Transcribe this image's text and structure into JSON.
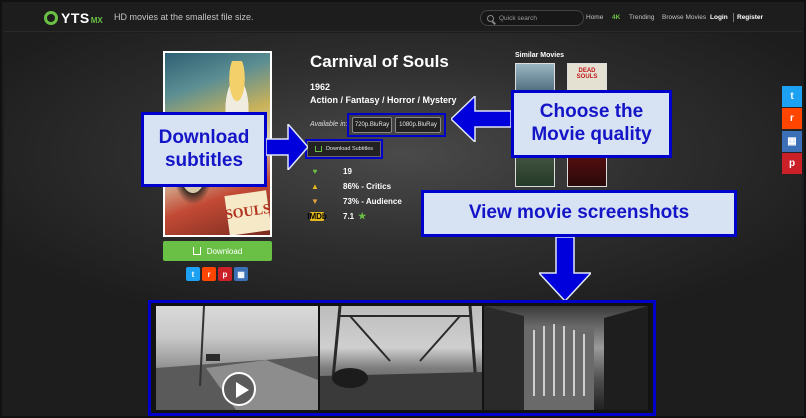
{
  "header": {
    "logo_text": "YTS",
    "logo_suffix": "MX",
    "tagline": "HD movies at the smallest file size.",
    "search_placeholder": "Quick search",
    "nav": [
      "Home",
      "4K",
      "Trending",
      "Browse Movies",
      "Login",
      "Register"
    ]
  },
  "poster": {
    "overlay_word": "SOULS"
  },
  "download_label": "Download",
  "share_icons": [
    "twitter-icon",
    "reddit-icon",
    "pinterest-icon",
    "more-icon"
  ],
  "movie": {
    "title": "Carnival of Souls",
    "year": "1962",
    "genres": "Action / Fantasy / Horror / Mystery",
    "available_label": "Available in:",
    "qualities": [
      "720p.BluRay",
      "1080p.BluRay"
    ],
    "subtitles_label": "Download Subtitles",
    "likes": "19",
    "critics": "86% - Critics",
    "audience": "73% - Audience",
    "imdb_label": "IMDb",
    "imdb_rating": "7.1"
  },
  "similar": {
    "heading": "Similar Movies",
    "items": [
      "",
      "DEAD SOULS",
      "",
      ""
    ]
  },
  "annotations": {
    "download_subtitles": "Download subtitles",
    "choose_quality": "Choose the Movie quality",
    "view_screenshots": "View movie screenshots"
  },
  "side_share": [
    "twitter-icon",
    "reddit-icon",
    "more-icon",
    "pinterest-icon"
  ],
  "colors": {
    "accent": "#6ac045",
    "annotation_blue": "#0000cc",
    "annotation_fill": "#d7e3f3",
    "twitter": "#1da1f2",
    "reddit": "#ff4500",
    "pinterest": "#cb2027",
    "more": "#3b6fb6"
  }
}
